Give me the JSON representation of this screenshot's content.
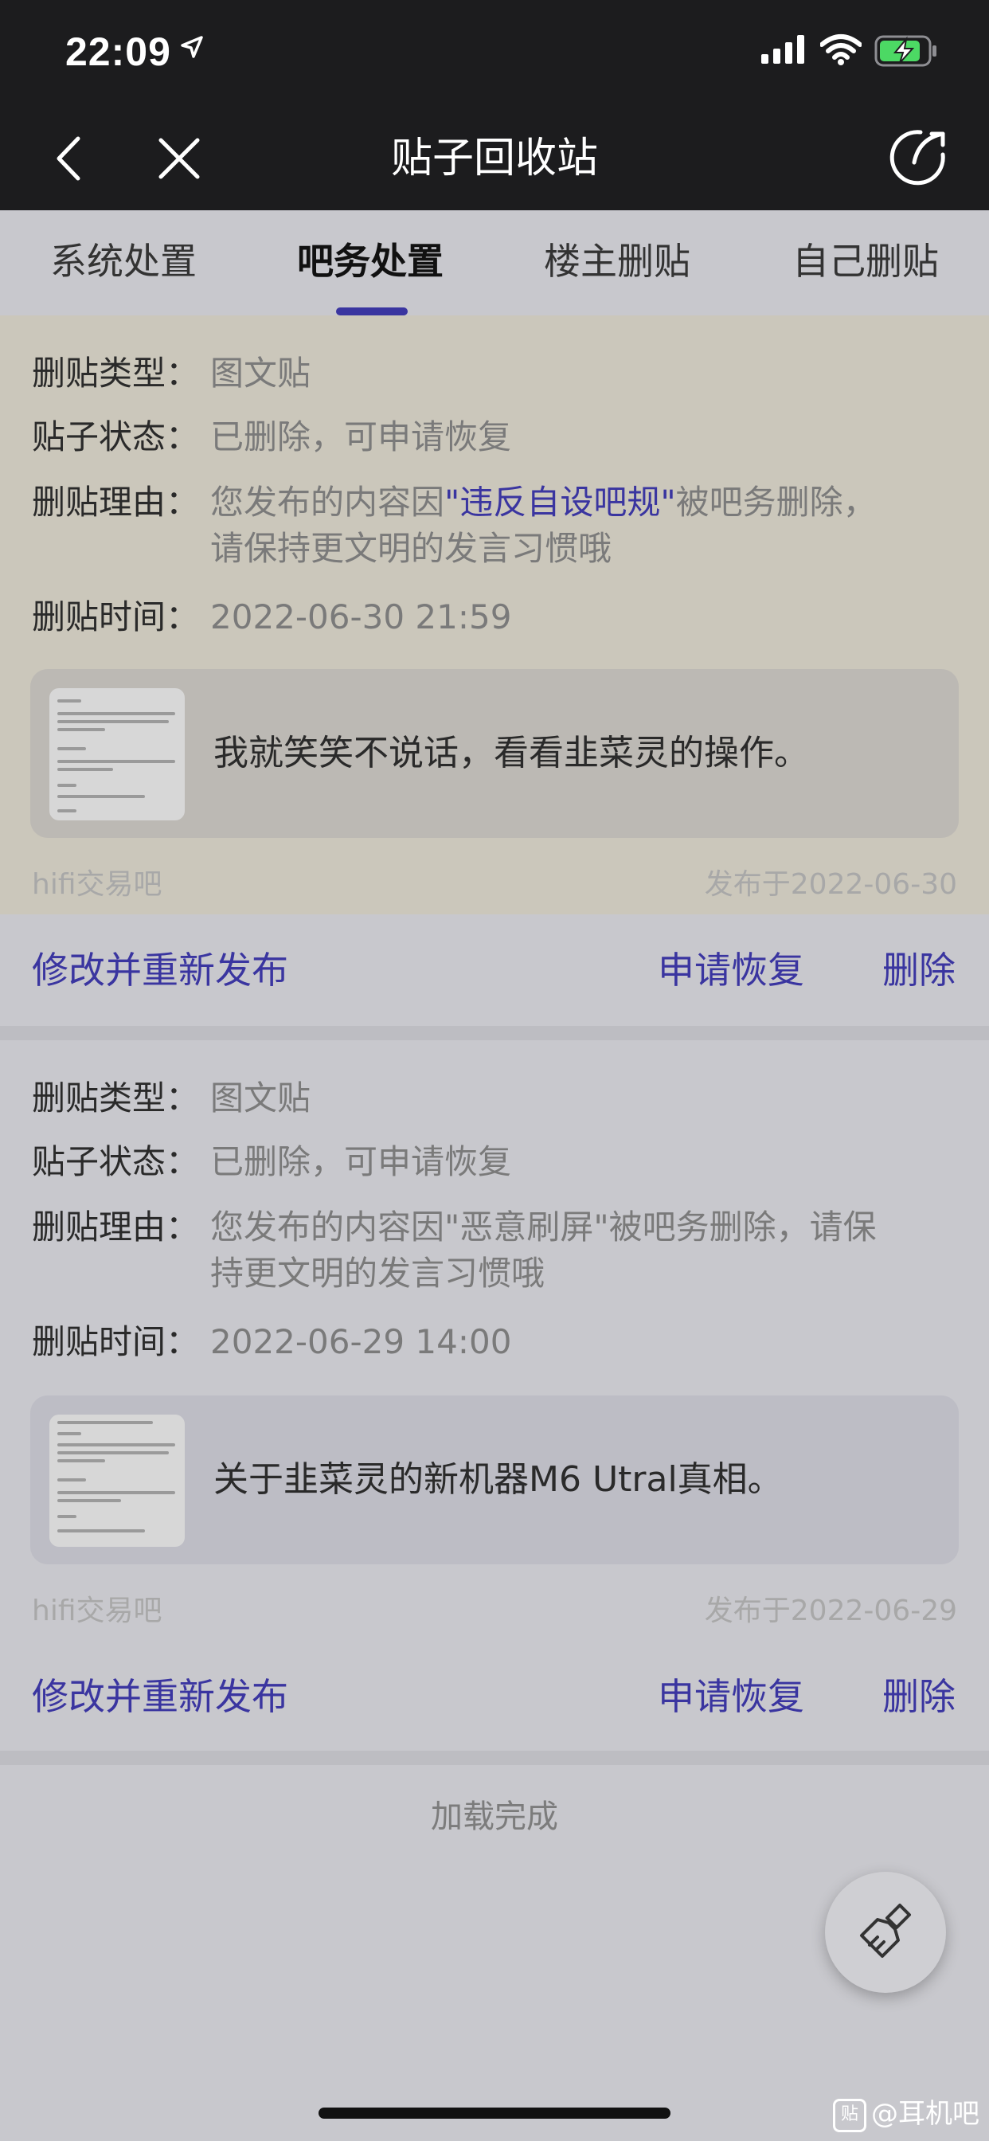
{
  "status_bar": {
    "time": "22:09"
  },
  "nav": {
    "title": "贴子回收站"
  },
  "tabs": [
    {
      "label": "系统处置"
    },
    {
      "label": "吧务处置"
    },
    {
      "label": "楼主删贴"
    },
    {
      "label": "自己删贴"
    }
  ],
  "labels": {
    "type": "删贴类型：",
    "status": "贴子状态：",
    "reason": "删贴理由：",
    "time": "删贴时间："
  },
  "posts": [
    {
      "type": "图文贴",
      "status": "已删除，可申请恢复",
      "reason_prefix": "您发布的内容因",
      "reason_rule": "\"违反自设吧规\"",
      "reason_suffix": "被吧务删除，",
      "reason_line2": "请保持更文明的发言习惯哦",
      "time": "2022-06-30 21:59",
      "preview_text": "我就笑笑不说话，看看韭菜灵的操作。",
      "forum": "hifi交易吧",
      "published": "发布于2022-06-30",
      "actions": {
        "republish": "修改并重新发布",
        "restore": "申请恢复",
        "delete": "删除"
      }
    },
    {
      "type": "图文贴",
      "status": "已删除，可申请恢复",
      "reason_line1": "您发布的内容因\"恶意刷屏\"被吧务删除，请保",
      "reason_line2": "持更文明的发言习惯哦",
      "time": "2022-06-29 14:00",
      "preview_text": "关于韭菜灵的新机器M6 Utral真相。",
      "forum": "hifi交易吧",
      "published": "发布于2022-06-29",
      "actions": {
        "republish": "修改并重新发布",
        "restore": "申请恢复",
        "delete": "删除"
      }
    }
  ],
  "footer": {
    "loaded": "加载完成",
    "watermark": "@耳机吧",
    "watermark_badge": "贴"
  },
  "colors": {
    "accent": "#3a35a0",
    "header_bg": "#1c1c1e"
  }
}
